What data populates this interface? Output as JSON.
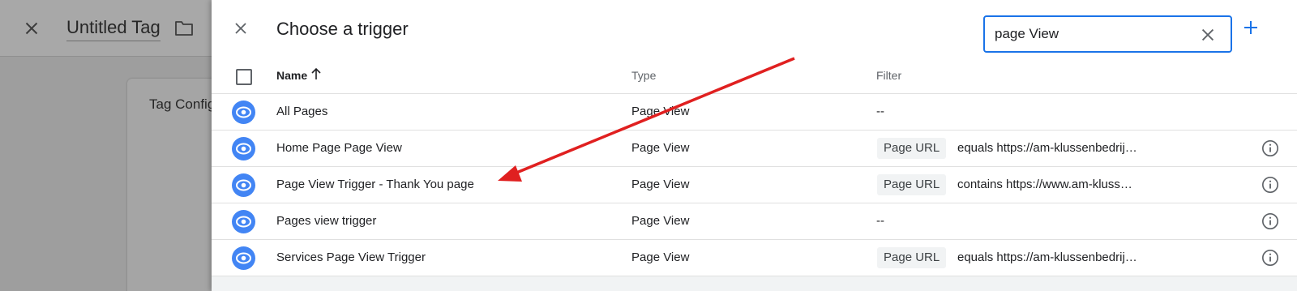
{
  "background": {
    "tag_title": "Untitled Tag",
    "card_title": "Tag Configuration"
  },
  "panel": {
    "title": "Choose a trigger",
    "search": {
      "value": "page View",
      "placeholder": "Search"
    }
  },
  "table": {
    "headers": {
      "name": "Name",
      "type": "Type",
      "filter": "Filter"
    },
    "rows": [
      {
        "name": "All Pages",
        "type": "Page View",
        "filter_chip": "",
        "filter_condition": "",
        "filter_text": "--",
        "has_info": false
      },
      {
        "name": "Home Page Page View",
        "type": "Page View",
        "filter_chip": "Page URL",
        "filter_condition": "equals https://am-klussenbedrij…",
        "filter_text": "",
        "has_info": true
      },
      {
        "name": "Page View Trigger - Thank You page",
        "type": "Page View",
        "filter_chip": "Page URL",
        "filter_condition": "contains https://www.am-kluss…",
        "filter_text": "",
        "has_info": true
      },
      {
        "name": "Pages view trigger",
        "type": "Page View",
        "filter_chip": "",
        "filter_condition": "",
        "filter_text": "--",
        "has_info": true
      },
      {
        "name": "Services Page View Trigger",
        "type": "Page View",
        "filter_chip": "Page URL",
        "filter_condition": "equals https://am-klussenbedrij…",
        "filter_text": "",
        "has_info": true
      }
    ]
  },
  "colors": {
    "accent": "#1a73e8",
    "trigger_icon": "#4285f4",
    "annotation_arrow": "#e02020"
  },
  "icons": {
    "close": "close-icon",
    "folder": "folder-icon",
    "search_clear": "clear-icon",
    "add": "add-icon",
    "sort": "arrow-up-icon",
    "trigger": "eye-icon",
    "info": "info-icon"
  }
}
